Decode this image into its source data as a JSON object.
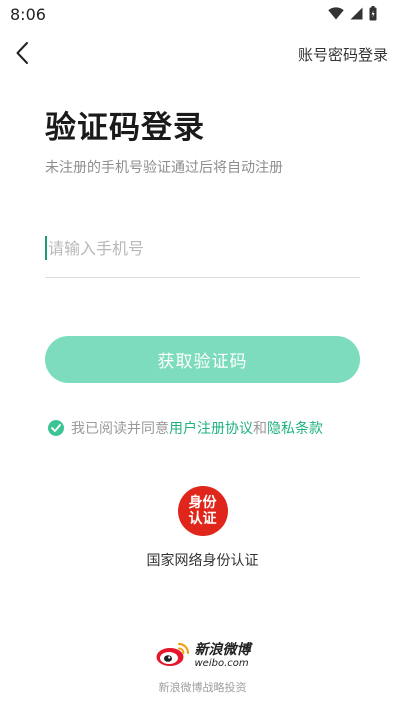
{
  "status_bar": {
    "time": "8:06",
    "icons": [
      "wifi-icon",
      "signal-icon",
      "battery-icon"
    ]
  },
  "topbar": {
    "back_icon": "chevron-left-icon",
    "alt_login_label": "账号密码登录"
  },
  "title": "验证码登录",
  "subtitle": "未注册的手机号验证通过后将自动注册",
  "phone_input": {
    "value": "",
    "placeholder": "请输入手机号"
  },
  "get_code_button": "获取验证码",
  "agreement": {
    "checked": true,
    "prefix": "我已阅读并同意",
    "user_agreement": "用户注册协议",
    "conjunction": "和",
    "privacy_policy": "隐私条款"
  },
  "identity": {
    "badge_line1": "身份",
    "badge_line2": "认证",
    "label": "国家网络身份认证"
  },
  "footer": {
    "brand_cn": "新浪微博",
    "brand_en": "weibo.com",
    "caption": "新浪微博战略投资"
  },
  "colors": {
    "accent": "#7ddcbd",
    "link": "#1fb37e",
    "check": "#3ec494",
    "badge_red": "#e0251b"
  }
}
